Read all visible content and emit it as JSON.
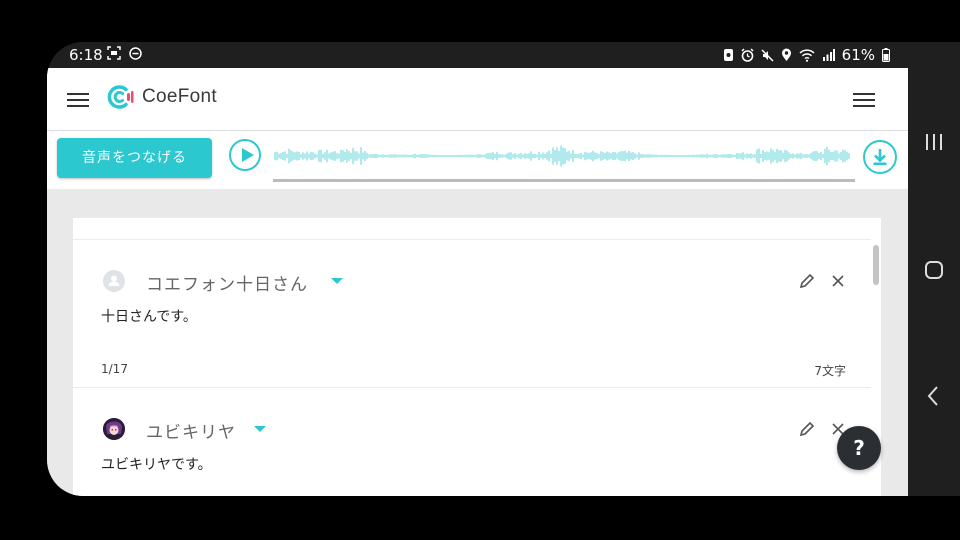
{
  "status_bar": {
    "time": "6:18",
    "battery": "61%"
  },
  "header": {
    "logo_text": "CoeFont",
    "brand_color": "#2cc8cf",
    "logo_accent_color": "#ee4d70"
  },
  "toolbar": {
    "connect_label": "音声をつなげる"
  },
  "cards": [
    {
      "voice_name": "コエフォン十日さん",
      "text": "十日さんです。",
      "position": "1/17",
      "char_count": "7文字"
    },
    {
      "voice_name": "ユビキリヤ",
      "text": "ユビキリヤです。"
    }
  ],
  "help": {
    "label": "?"
  },
  "icons": {
    "menu": "menu-icon",
    "play": "play-icon",
    "download": "download-icon",
    "edit": "pencil-icon",
    "close": "close-icon",
    "help": "help-icon"
  }
}
